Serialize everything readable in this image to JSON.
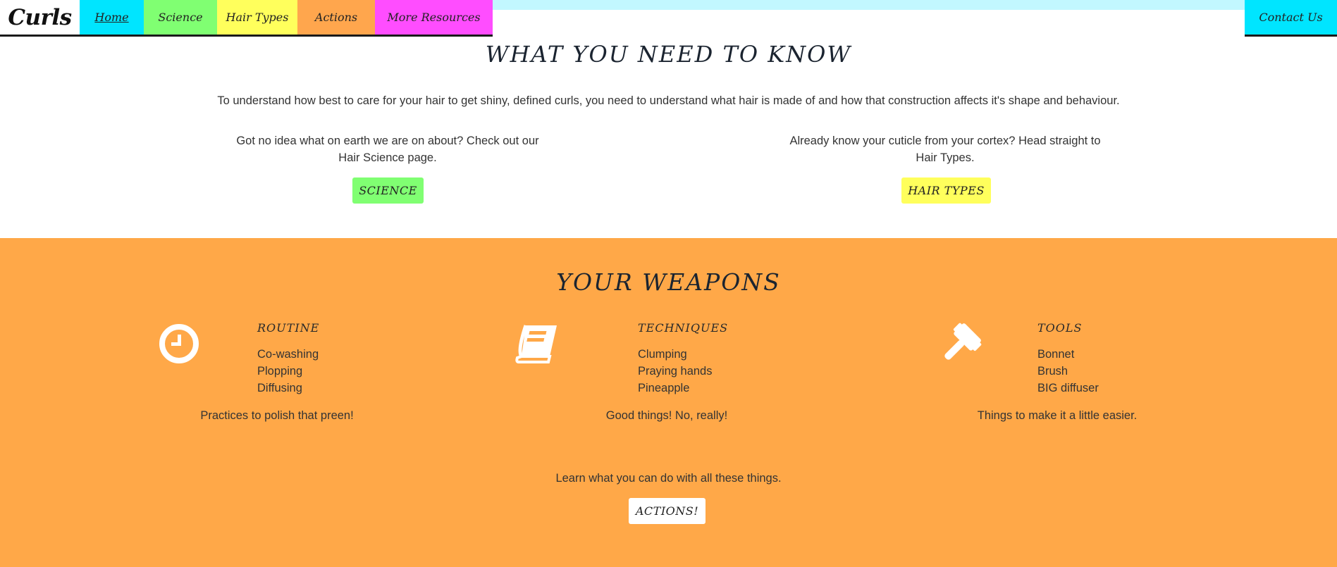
{
  "nav": {
    "brand": "Curls",
    "items": [
      {
        "label": "Home"
      },
      {
        "label": "Science"
      },
      {
        "label": "Hair Types"
      },
      {
        "label": "Actions"
      },
      {
        "label": "More Resources"
      }
    ],
    "contact": "Contact Us"
  },
  "know": {
    "title": "WHAT YOU NEED TO KNOW",
    "intro": "To understand how best to care for your hair to get shiny, defined curls, you need to understand what hair is made of and how that construction affects it's shape and behaviour.",
    "left_text": "Got no idea what on earth we are on about? Check out our Hair Science page.",
    "left_button": "SCIENCE",
    "right_text": "Already know your cuticle from your cortex? Head straight to Hair Types.",
    "right_button": "HAIR TYPES"
  },
  "weapons": {
    "title": "YOUR WEAPONS",
    "columns": [
      {
        "icon": "clock-icon",
        "title": "ROUTINE",
        "items": [
          "Co-washing",
          "Plopping",
          "Diffusing"
        ],
        "caption": "Practices to polish that preen!"
      },
      {
        "icon": "book-icon",
        "title": "TECHNIQUES",
        "items": [
          "Clumping",
          "Praying hands",
          "Pineapple"
        ],
        "caption": "Good things! No, really!"
      },
      {
        "icon": "gavel-icon",
        "title": "TOOLS",
        "items": [
          "Bonnet",
          "Brush",
          "BIG diffuser"
        ],
        "caption": "Things to make it a little easier."
      }
    ],
    "learn_text": "Learn what you can do with all these things.",
    "actions_button": "ACTIONS!"
  },
  "colors": {
    "home": "#00e5ff",
    "science": "#80ff72",
    "hair_types": "#ffff5c",
    "actions": "#ffa64d",
    "more_resources": "#ff4dff",
    "weapons_bg": "#ffa848"
  }
}
